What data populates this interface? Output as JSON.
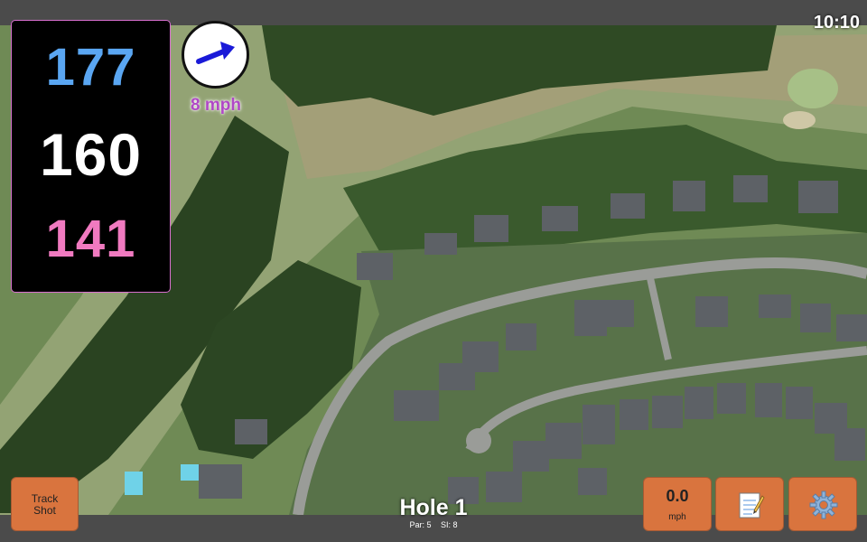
{
  "status": {
    "time": "10:10"
  },
  "distances": {
    "back": "177",
    "middle": "160",
    "front": "141"
  },
  "wind": {
    "speed": "8 mph",
    "direction_icon": "arrow-right-icon"
  },
  "buttons": {
    "track_shot": {
      "label": "Track Shot",
      "line1": "Track",
      "line2": "Shot"
    },
    "speed": {
      "value": "0.0",
      "unit": "mph"
    },
    "notes": {
      "icon": "notepad-icon"
    },
    "settings": {
      "icon": "gear-icon"
    }
  },
  "hole": {
    "title": "Hole 1",
    "par": "Par: 5",
    "si": "SI: 8"
  },
  "colors": {
    "back_distance": "#5aa6f2",
    "middle_distance": "#ffffff",
    "front_distance": "#f07ac0",
    "wind_text": "#b048c6",
    "button": "#d9743e",
    "panel_border": "#d86fcf"
  }
}
